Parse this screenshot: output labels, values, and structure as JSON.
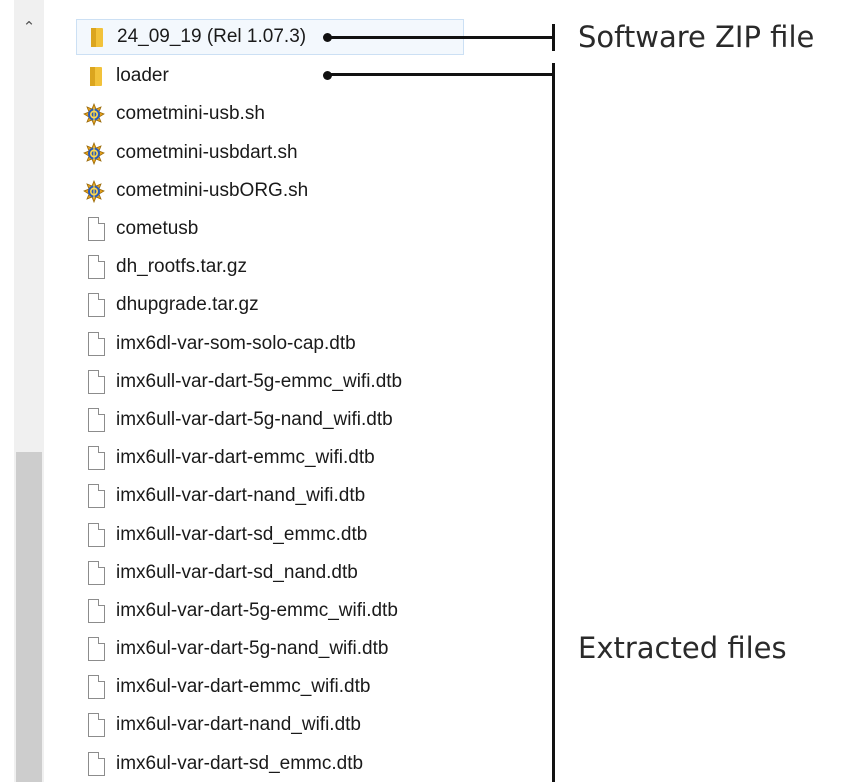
{
  "files": [
    {
      "name": "24_09_19 (Rel 1.07.3)",
      "icon": "folder-icon",
      "selected": true
    },
    {
      "name": "loader",
      "icon": "folder-icon"
    },
    {
      "name": "cometmini-usb.sh",
      "icon": "shell-script-icon"
    },
    {
      "name": "cometmini-usbdart.sh",
      "icon": "shell-script-icon"
    },
    {
      "name": "cometmini-usbORG.sh",
      "icon": "shell-script-icon"
    },
    {
      "name": "cometusb",
      "icon": "file-icon"
    },
    {
      "name": "dh_rootfs.tar.gz",
      "icon": "file-icon"
    },
    {
      "name": "dhupgrade.tar.gz",
      "icon": "file-icon"
    },
    {
      "name": "imx6dl-var-som-solo-cap.dtb",
      "icon": "file-icon"
    },
    {
      "name": "imx6ull-var-dart-5g-emmc_wifi.dtb",
      "icon": "file-icon"
    },
    {
      "name": "imx6ull-var-dart-5g-nand_wifi.dtb",
      "icon": "file-icon"
    },
    {
      "name": "imx6ull-var-dart-emmc_wifi.dtb",
      "icon": "file-icon"
    },
    {
      "name": "imx6ull-var-dart-nand_wifi.dtb",
      "icon": "file-icon"
    },
    {
      "name": "imx6ull-var-dart-sd_emmc.dtb",
      "icon": "file-icon"
    },
    {
      "name": "imx6ull-var-dart-sd_nand.dtb",
      "icon": "file-icon"
    },
    {
      "name": "imx6ul-var-dart-5g-emmc_wifi.dtb",
      "icon": "file-icon"
    },
    {
      "name": "imx6ul-var-dart-5g-nand_wifi.dtb",
      "icon": "file-icon"
    },
    {
      "name": "imx6ul-var-dart-emmc_wifi.dtb",
      "icon": "file-icon"
    },
    {
      "name": "imx6ul-var-dart-nand_wifi.dtb",
      "icon": "file-icon"
    },
    {
      "name": "imx6ul-var-dart-sd_emmc.dtb",
      "icon": "file-icon"
    }
  ],
  "annotations": {
    "zip_label": "Software ZIP file",
    "extracted_label": "Extracted files"
  },
  "colors": {
    "folder": "#f2c23a",
    "selection_border": "#cce0f4",
    "annotation_line": "#111111"
  }
}
